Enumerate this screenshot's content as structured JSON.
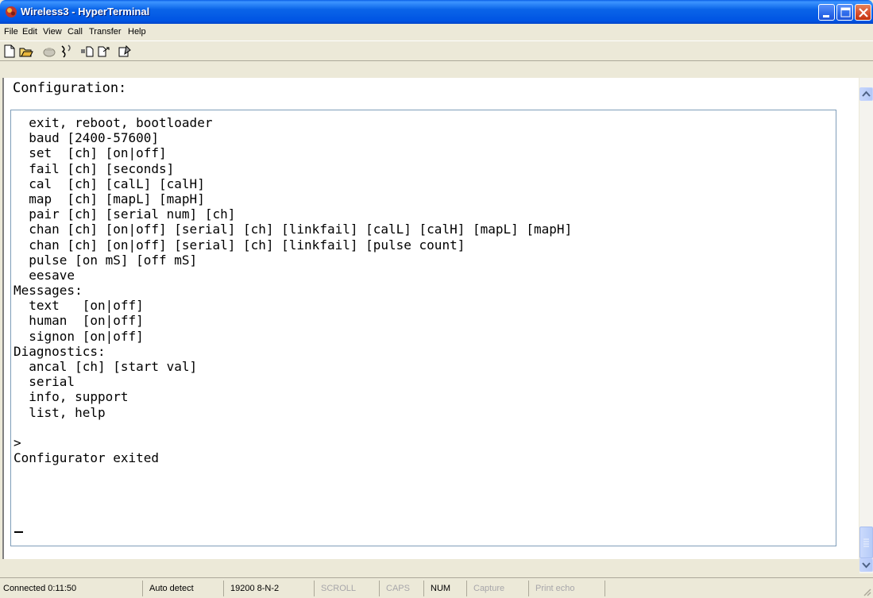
{
  "window": {
    "title": "Wireless3 - HyperTerminal"
  },
  "menu": {
    "items": [
      "File",
      "Edit",
      "View",
      "Call",
      "Transfer",
      "Help"
    ]
  },
  "toolbar": {
    "icons": [
      "new-icon",
      "open-icon",
      "connect-icon",
      "disconnect-icon",
      "send-icon",
      "receive-icon",
      "properties-icon"
    ]
  },
  "terminal": {
    "header": "Configuration:",
    "lines": [
      "  exit, reboot, bootloader",
      "  baud [2400-57600]",
      "  set  [ch] [on|off]",
      "  fail [ch] [seconds]",
      "  cal  [ch] [calL] [calH]",
      "  map  [ch] [mapL] [mapH]",
      "  pair [ch] [serial num] [ch]",
      "  chan [ch] [on|off] [serial] [ch] [linkfail] [calL] [calH] [mapL] [mapH]",
      "  chan [ch] [on|off] [serial] [ch] [linkfail] [pulse count]",
      "  pulse [on mS] [off mS]",
      "  eesave",
      "Messages:",
      "  text   [on|off]",
      "  human  [on|off]",
      "  signon [on|off]",
      "Diagnostics:",
      "  ancal [ch] [start val]",
      "  serial",
      "  info, support",
      "  list, help",
      "",
      ">",
      "Configurator exited"
    ]
  },
  "statusbar": {
    "connected": "Connected 0:11:50",
    "detect": "Auto detect",
    "settings": "19200 8-N-2",
    "scroll": "SCROLL",
    "caps": "CAPS",
    "num": "NUM",
    "capture": "Capture",
    "print_echo": "Print echo"
  }
}
